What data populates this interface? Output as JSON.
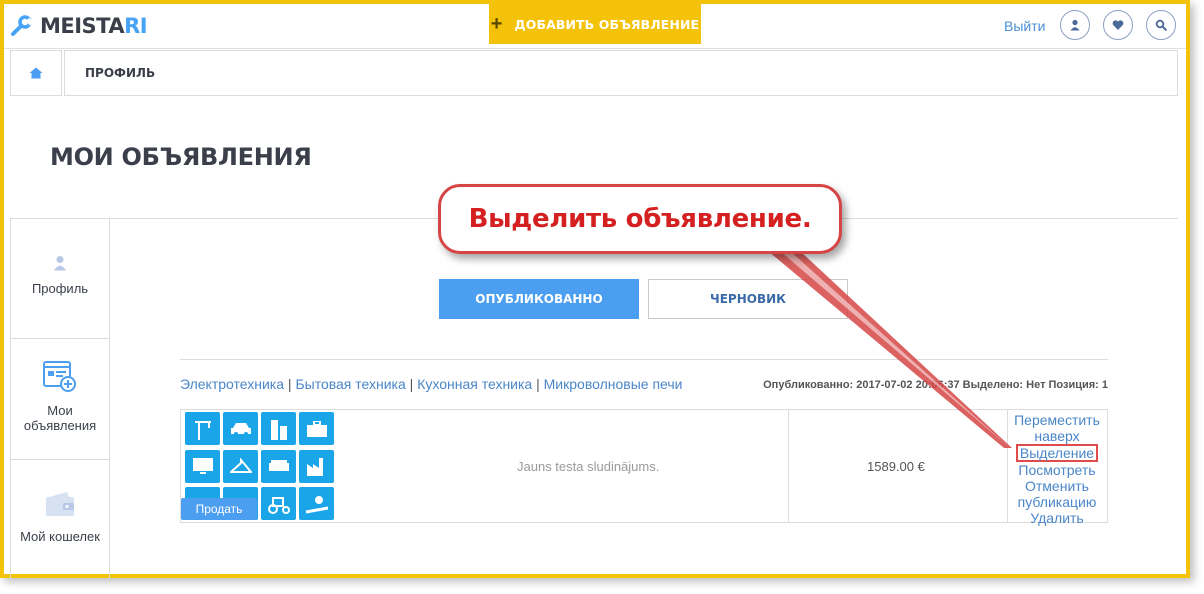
{
  "header": {
    "logo_main": "MEISTA",
    "logo_accent": "RI",
    "add_button": "ДОБАВИТЬ ОБЪЯВЛЕНИЕ",
    "logout": "Выйти"
  },
  "breadcrumb": {
    "current": "ПРОФИЛЬ"
  },
  "page_title": "МОИ ОБЪЯВЛЕНИЯ",
  "sidebar": {
    "items": [
      {
        "label": "Профиль",
        "icon": "user-icon"
      },
      {
        "label_line1": "Мои",
        "label_line2": "объявления",
        "icon": "ads-icon"
      },
      {
        "label": "Мой кошелек",
        "icon": "wallet-icon"
      }
    ]
  },
  "tabs": {
    "published": "ОПУБЛИКОВАННО",
    "draft": "ЧЕРНОВИК"
  },
  "listing": {
    "categories": [
      "Электротехника",
      "Бытовая техника",
      "Кухонная техника",
      "Микроволновые печи"
    ],
    "separator": "|",
    "meta": "Опубликованно: 2017-07-02 20:06:37 Выделено: Нет Позиция: 1",
    "title": "Jauns testa sludinājums.",
    "price": "1589.00 €",
    "sell_button": "Продать",
    "actions": {
      "move_up_1": "Переместить",
      "move_up_2": "наверх",
      "highlight": "Выделение",
      "view": "Посмотреть",
      "unpublish_1": "Отменить",
      "unpublish_2": "публикацию",
      "delete": "Удалить"
    }
  },
  "callout": {
    "text": "Выделить объявление."
  },
  "colors": {
    "accent_yellow": "#f5c20a",
    "primary_blue": "#4b9ef0",
    "link_blue": "#4a86c8",
    "tile_blue": "#1aa5e8",
    "callout_red": "#d42020"
  }
}
